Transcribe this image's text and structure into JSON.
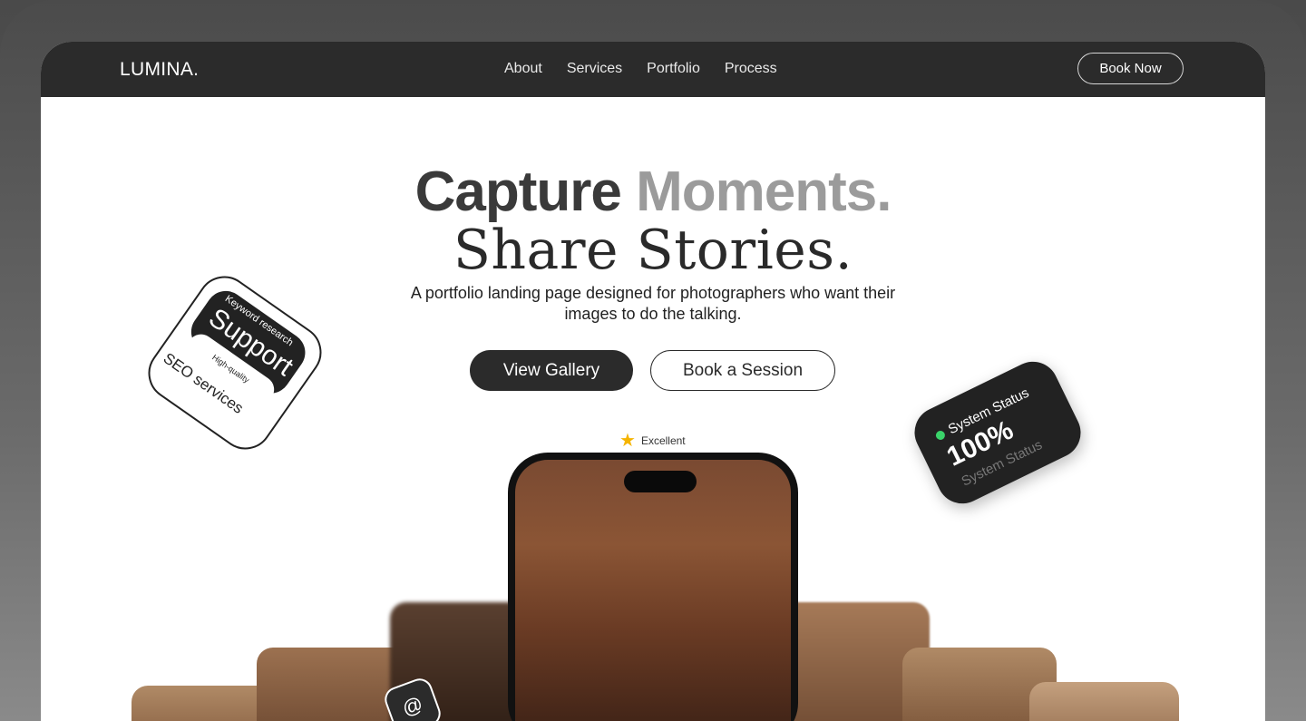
{
  "nav": {
    "logo": "LUMINA.",
    "links": [
      "About",
      "Services",
      "Portfolio",
      "Process"
    ],
    "cta": "Book Now"
  },
  "hero": {
    "headline_part1": "Capture",
    "headline_part2": "Moments.",
    "headline_line2": "Share Stories.",
    "subtitle": "A portfolio landing page designed for photographers who want their images to do the talking.",
    "primary_button": "View Gallery",
    "secondary_button": "Book a Session",
    "rating_label": "Excellent"
  },
  "sticker_left": {
    "top_text": "Keyword research",
    "title": "Support",
    "pill": "High-quality",
    "bottom_text": "SEO services"
  },
  "status_card": {
    "label": "System Status",
    "value": "100%",
    "label_secondary": "System Status",
    "dot_color": "#3ad36a"
  },
  "badge": {
    "icon": "at-icon",
    "symbol": "@"
  },
  "colors": {
    "dark": "#2b2b2b",
    "accent_grey": "#9b9b9b",
    "star": "#f5b400"
  }
}
